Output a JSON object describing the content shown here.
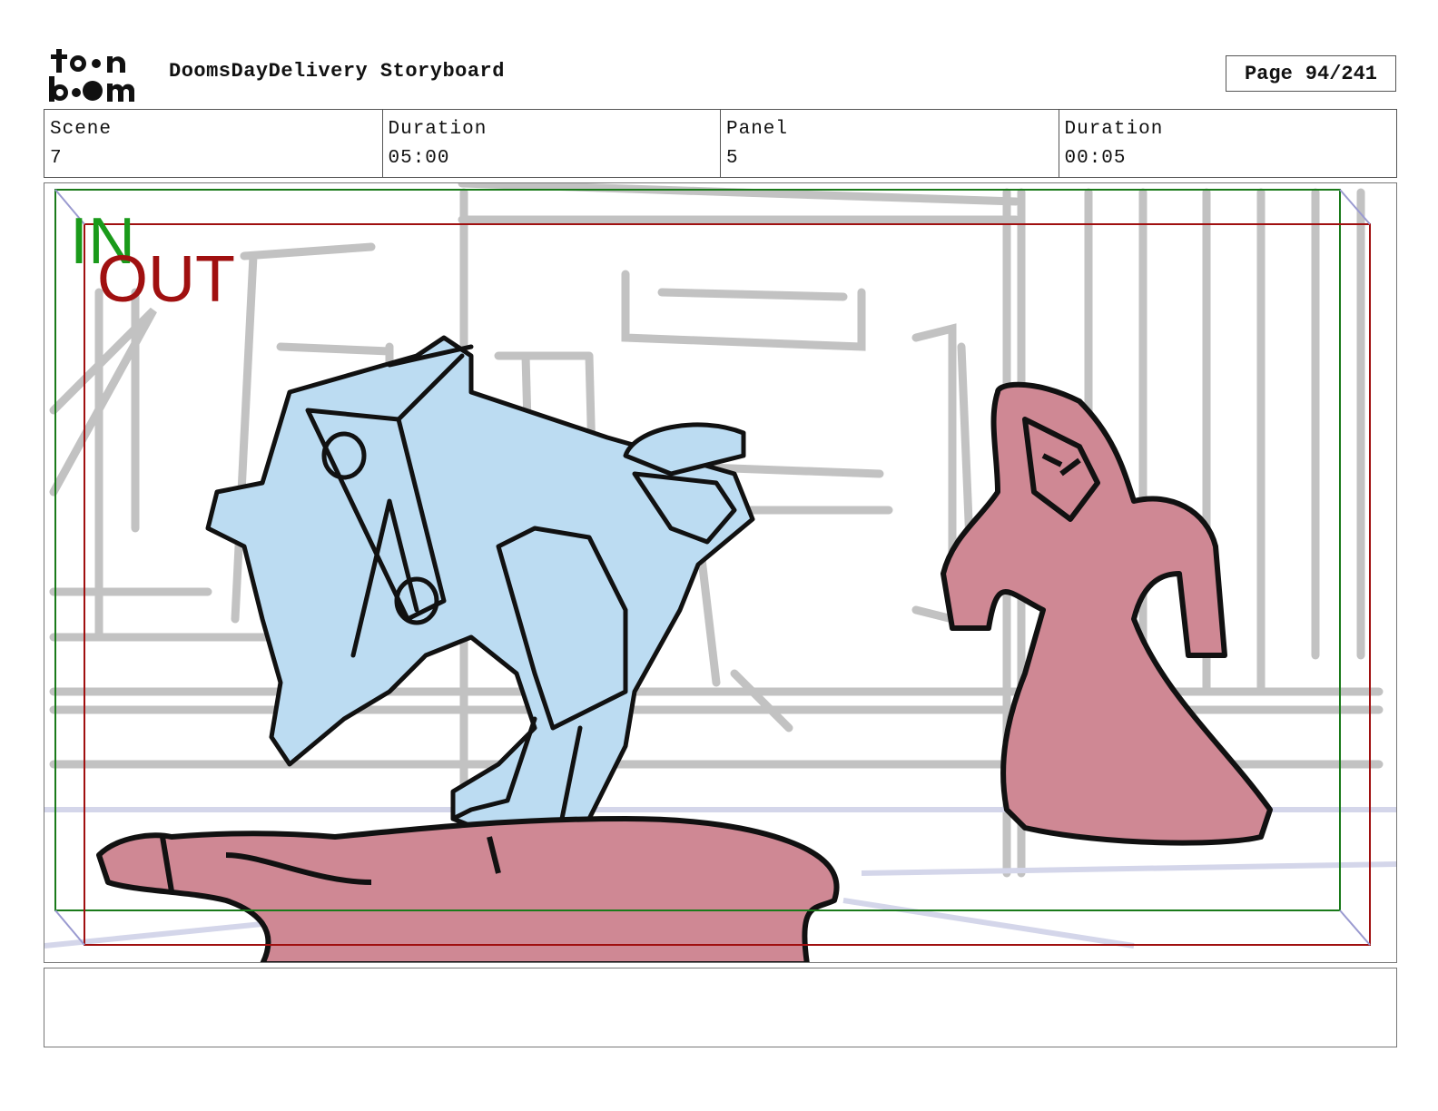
{
  "header": {
    "logo_text": "toonboom",
    "title": "DoomsDayDelivery Storyboard",
    "page_label": "Page",
    "page_value": "94/241"
  },
  "info": {
    "scene_label": "Scene",
    "scene_value": "7",
    "duration_label": "Duration",
    "duration_value": "05:00",
    "panel_label": "Panel",
    "panel_value": "5",
    "panel_duration_label": "Duration",
    "panel_duration_value": "00:05"
  },
  "frame": {
    "in_label": "IN",
    "out_label": "OUT",
    "in_color": "#1a9a1a",
    "out_color": "#a01010"
  },
  "notes": {
    "text": ""
  },
  "colors": {
    "courier_fill": "#bcdcf2",
    "creature_fill": "#cf8894",
    "background_sketch": "#bdbdbd"
  }
}
